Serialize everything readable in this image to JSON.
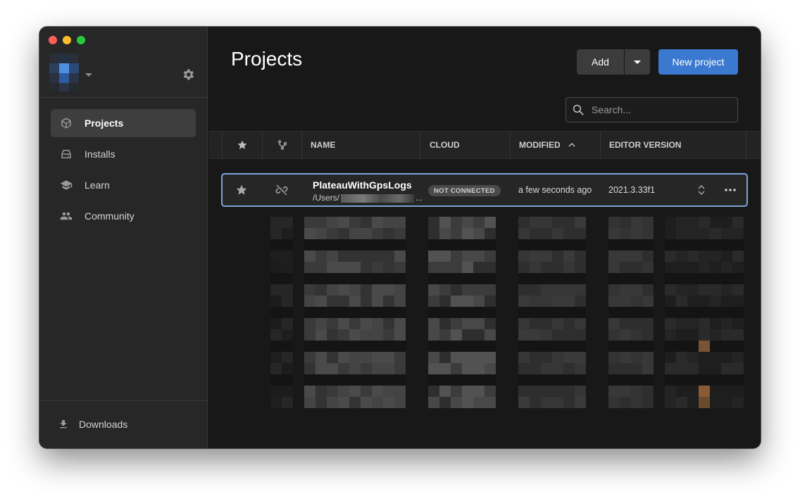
{
  "sidebar": {
    "items": [
      {
        "label": "Projects",
        "icon": "cube-icon",
        "active": true
      },
      {
        "label": "Installs",
        "icon": "drive-icon",
        "active": false
      },
      {
        "label": "Learn",
        "icon": "graduation-cap-icon",
        "active": false
      },
      {
        "label": "Community",
        "icon": "people-icon",
        "active": false
      }
    ],
    "downloads_label": "Downloads"
  },
  "header": {
    "title": "Projects",
    "add_label": "Add",
    "new_project_label": "New project"
  },
  "search": {
    "placeholder": "Search..."
  },
  "table": {
    "columns": [
      "NAME",
      "CLOUD",
      "MODIFIED",
      "EDITOR VERSION"
    ],
    "sort_column": "MODIFIED",
    "sort_direction": "ascending",
    "rows": [
      {
        "name": "PlateauWithGpsLogs",
        "path_prefix": "/Users/",
        "path_suffix": "...",
        "cloud": "NOT CONNECTED",
        "modified": "a few seconds ago",
        "editor_version": "2021.3.33f1"
      }
    ]
  },
  "colors": {
    "accent": "#3a79cf",
    "selection_border": "#7ba3d8",
    "background": "#181818",
    "sidebar": "#272727"
  }
}
